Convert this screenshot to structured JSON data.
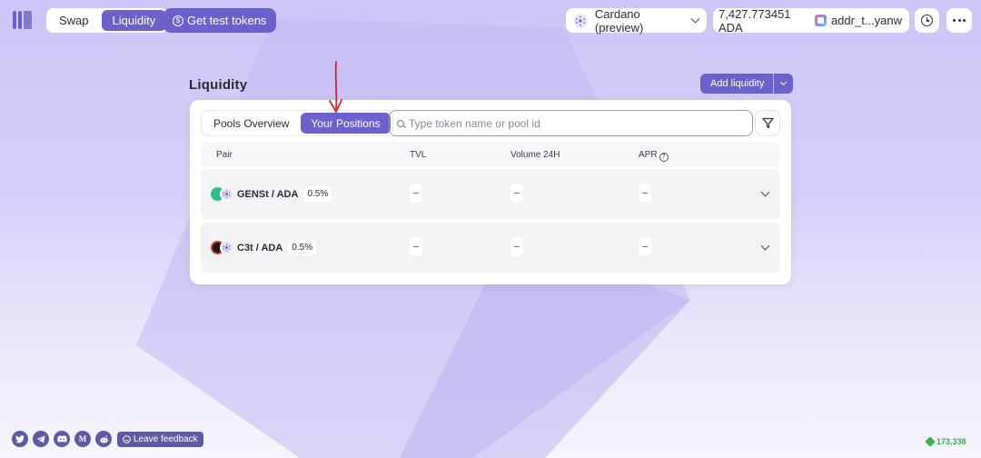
{
  "nav": {
    "swap_label": "Swap",
    "liquidity_label": "Liquidity",
    "test_tokens_label": "Get test tokens",
    "test_tokens_symbol": "$"
  },
  "network": {
    "label": "Cardano (preview)"
  },
  "wallet": {
    "balance": "7,427.773451 ADA",
    "address": "addr_t...yanw"
  },
  "page": {
    "title": "Liquidity",
    "add_liquidity_label": "Add liquidity"
  },
  "tabs": [
    {
      "label": "Pools Overview",
      "active": false
    },
    {
      "label": "Your Positions",
      "active": true
    }
  ],
  "search": {
    "placeholder": "Type token name or pool id",
    "value": ""
  },
  "table": {
    "columns": [
      "Pair",
      "TVL",
      "Volume 24H",
      "APR"
    ],
    "apr_help_symbol": "?",
    "rows": [
      {
        "pair": "GENSt / ADA",
        "fee": "0.5%",
        "tvl": "–",
        "volume": "–",
        "apr": "–",
        "token_color": "#2bbf8a"
      },
      {
        "pair": "C3t / ADA",
        "fee": "0.5%",
        "tvl": "–",
        "volume": "–",
        "apr": "–",
        "token_color": "#1a1a1a"
      }
    ]
  },
  "footer": {
    "social_icons": [
      "twitter-icon",
      "telegram-icon",
      "discord-icon",
      "medium-icon",
      "reddit-icon"
    ],
    "medium_letter": "M",
    "feedback_label": "Leave feedback",
    "block_height": "173,338"
  },
  "colors": {
    "accent": "#6b61cc",
    "annotation_arrow": "#d9262b",
    "block_green": "#36b24c"
  }
}
